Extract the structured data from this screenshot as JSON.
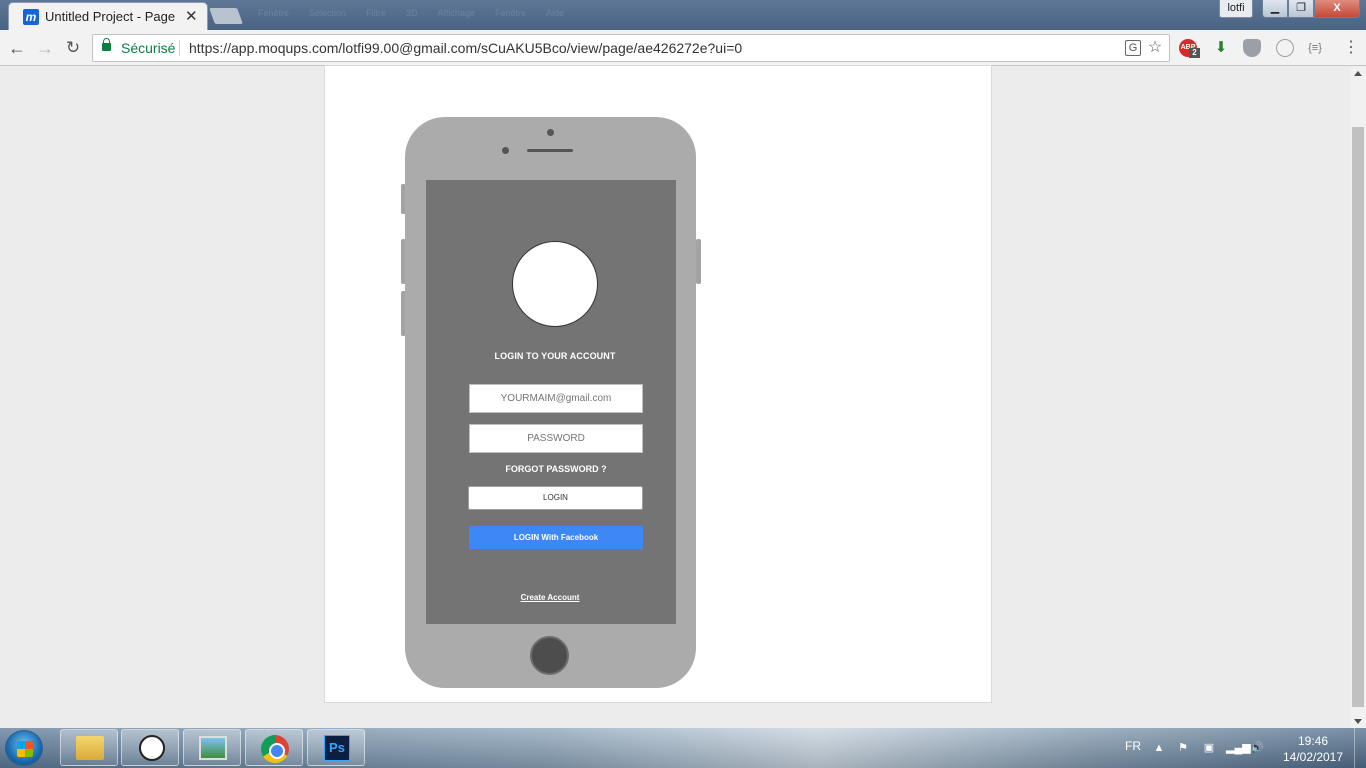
{
  "browser": {
    "tab": {
      "title": "Untitled Project - Page",
      "close": "✕",
      "favicon_letter": "m"
    },
    "ghost_menu": [
      "Fenêtre",
      "Sélection",
      "Filtre",
      "3D",
      "Affichage",
      "Fenêtre",
      "Aide"
    ],
    "user_badge": "lotfi",
    "window_controls": {
      "minimize": "▁",
      "maximize": "❐",
      "close": "X"
    },
    "toolbar": {
      "back": "←",
      "forward": "→",
      "reload": "↻",
      "secure_label": "Sécurisé",
      "url": "https://app.moqups.com/lotfi99.00@gmail.com/sCuAKU5Bco/view/page/ae426272e?ui=0",
      "translate": "G",
      "star": "☆",
      "abp_label": "ABP",
      "abp_count": "2",
      "ext2": "⬇",
      "ext5": "{≡}",
      "menu": "⋮"
    }
  },
  "mockup": {
    "heading": "LOGIN TO YOUR ACCOUNT",
    "email_placeholder": "YOURMAIM@gmail.com",
    "password_placeholder": "PASSWORD",
    "forgot_password": "FORGOT PASSWORD ?",
    "login_button": "LOGIN",
    "facebook_button": "LOGIN With Facebook",
    "create_account": "Create Account"
  },
  "taskbar": {
    "ps_label": "Ps",
    "smiley": "☺",
    "language": "FR",
    "tray_arrow": "▲",
    "tray_flag": "⚑",
    "tray_net": "▣",
    "tray_signal": "▂▄▆",
    "tray_volume": "🔊",
    "time": "19:46",
    "date": "14/02/2017"
  },
  "colors": {
    "facebook_button": "#3d88f4",
    "phone_body": "#ababab",
    "phone_screen": "#747474",
    "secure_green": "#0b8043"
  }
}
